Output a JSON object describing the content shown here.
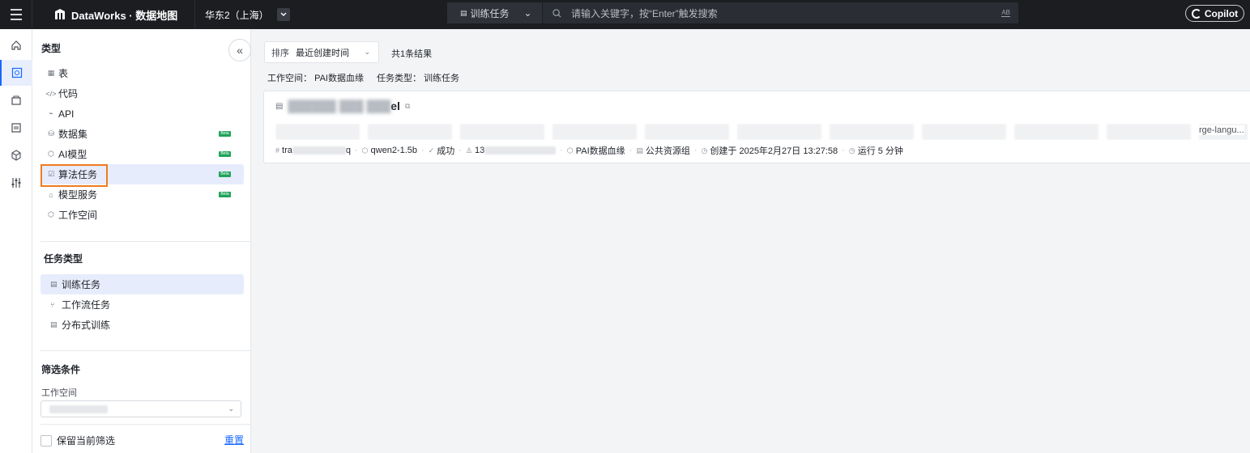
{
  "topbar": {
    "brand": "DataWorks · 数据地图",
    "region": "华东2（上海）",
    "search_scope": "训练任务",
    "search_placeholder": "请输入关键字，按“Enter”触发搜索",
    "search_hint": "AB",
    "copilot": "Copilot"
  },
  "sidebar": {
    "type_title": "类型",
    "types": [
      {
        "label": "表",
        "icon": "table-icon",
        "beta": false
      },
      {
        "label": "代码",
        "icon": "code-icon",
        "beta": false
      },
      {
        "label": "API",
        "icon": "api-icon",
        "beta": false
      },
      {
        "label": "数据集",
        "icon": "dataset-icon",
        "beta": true
      },
      {
        "label": "AI模型",
        "icon": "ai-model-icon",
        "beta": true
      },
      {
        "label": "算法任务",
        "icon": "algorithm-task-icon",
        "beta": true,
        "selected": true
      },
      {
        "label": "模型服务",
        "icon": "model-service-icon",
        "beta": true
      },
      {
        "label": "工作空间",
        "icon": "workspace-icon",
        "beta": false
      }
    ],
    "beta_label": "Beta",
    "task_type_title": "任务类型",
    "task_types": [
      {
        "label": "训练任务",
        "selected": true
      },
      {
        "label": "工作流任务",
        "selected": false
      },
      {
        "label": "分布式训练",
        "selected": false
      }
    ],
    "filter_title": "筛选条件",
    "workspace_label": "工作空间",
    "keep_filter_label": "保留当前筛选",
    "reset_label": "重置"
  },
  "main": {
    "sort_label": "排序",
    "sort_value": "最近创建时间",
    "result_count": "共1条结果",
    "filter_workspace_key": "工作空间：",
    "filter_workspace_value": "PAI数据血缘",
    "filter_tasktype_key": "任务类型：",
    "filter_tasktype_value": "训练任务",
    "card": {
      "title_visible": "el",
      "tag_tail": "rge-langu...",
      "meta": {
        "id_prefix": "tra",
        "id_suffix": "q",
        "model": "qwen2-1.5b",
        "status": "成功",
        "user_prefix": "13",
        "workspace": "PAI数据血缘",
        "resource_group": "公共资源组",
        "created": "创建于 2025年2月27日 13:27:58",
        "runtime": "运行 5 分钟"
      }
    }
  }
}
